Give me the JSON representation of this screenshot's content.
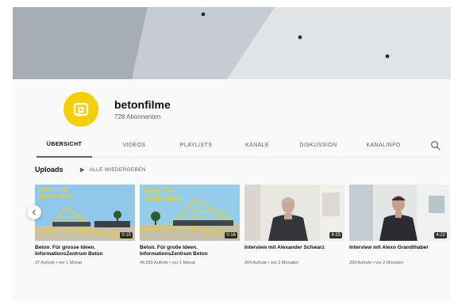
{
  "channel": {
    "name": "betonfilme",
    "subscribers": "728 Abonnenten"
  },
  "tabs": [
    {
      "label": "ÜBERSICHT",
      "active": true
    },
    {
      "label": "VIDEOS",
      "active": false
    },
    {
      "label": "PLAYLISTS",
      "active": false
    },
    {
      "label": "KANÄLE",
      "active": false
    },
    {
      "label": "DISKUSSION",
      "active": false
    },
    {
      "label": "KANALINFO",
      "active": false
    }
  ],
  "shelf": {
    "title": "Uploads",
    "play_all": "ALLE WIEDERGEBEN"
  },
  "videos": [
    {
      "title": "Beton. Für grosse Ideen. InformationsZentrum Beton",
      "meta": "37 Aufrufe • vor 1 Monat",
      "duration": "0:15"
    },
    {
      "title": "Beton. Für große Ideen. InformationsZentrum Beton",
      "meta": "46.559 Aufrufe • vor 1 Monat",
      "duration": "0:16"
    },
    {
      "title": "Interview mit Alexander Schwarz",
      "meta": "264 Aufrufe • vor 2 Monaten",
      "duration": "4:25"
    },
    {
      "title": "Interview mit Alexo Grandthaber",
      "meta": "293 Aufrufe • vor 2 Monaten",
      "duration": "4:22"
    }
  ],
  "thumb_text": {
    "v1": "Beton. Für grosse Ideen.",
    "v2": "Beton. Für große Ideen."
  },
  "colors": {
    "brand_yellow": "#f5d000",
    "background": "#f9f9f9"
  },
  "icons": [
    "channel-logo",
    "search-icon",
    "play-all-icon",
    "chevron-left-icon"
  ]
}
